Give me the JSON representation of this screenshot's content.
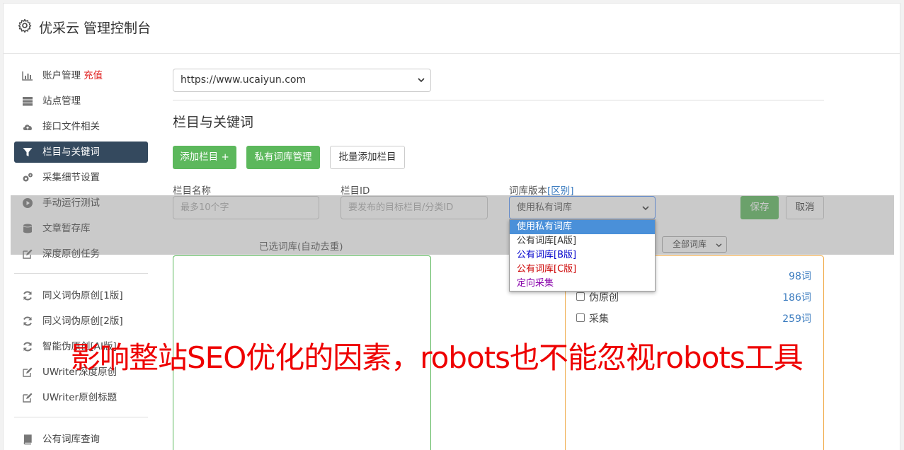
{
  "header": {
    "title": "优采云 管理控制台",
    "icon": "gear-icon"
  },
  "sidebar": {
    "items": [
      {
        "label": "账户管理",
        "extra": "充值",
        "icon": "bar-chart-icon"
      },
      {
        "label": "站点管理",
        "icon": "server-icon"
      },
      {
        "label": "接口文件相关",
        "icon": "cloud-upload-icon"
      },
      {
        "label": "栏目与关键词",
        "icon": "filter-icon",
        "active": true
      },
      {
        "label": "采集细节设置",
        "icon": "gears-icon"
      },
      {
        "label": "手动运行测试",
        "icon": "play-circle-icon"
      },
      {
        "label": "文章暂存库",
        "icon": "database-icon"
      },
      {
        "label": "深度原创任务",
        "icon": "edit-icon"
      },
      {
        "label": "同义词伪原创[1版]",
        "icon": "refresh-icon"
      },
      {
        "label": "同义词伪原创[2版]",
        "icon": "refresh-icon"
      },
      {
        "label": "智能伪原创[AI版]",
        "icon": "refresh-icon"
      },
      {
        "label": "UWriter深度原创",
        "icon": "edit-icon"
      },
      {
        "label": "UWriter原创标题",
        "icon": "edit-icon"
      },
      {
        "label": "公有词库查询",
        "icon": "book-icon"
      }
    ]
  },
  "site_select": {
    "value": "https://www.ucaiyun.com"
  },
  "section_title": "栏目与关键词",
  "toolbar": {
    "add_column": "添加栏目 +",
    "private_lib": "私有词库管理",
    "batch_add": "批量添加栏目"
  },
  "form": {
    "name_label": "栏目名称",
    "name_placeholder": "最多10个字",
    "id_label": "栏目ID",
    "id_placeholder": "要发布的目标栏目/分类ID",
    "version_label": "词库版本",
    "version_link": "[区别]",
    "version_value": "使用私有词库",
    "save": "保存",
    "cancel": "取消"
  },
  "dropdown": {
    "options": [
      {
        "label": "使用私有词库",
        "color": "#ffffff",
        "selected": true
      },
      {
        "label": "公有词库[A版]",
        "color": "#333333"
      },
      {
        "label": "公有词库[B版]",
        "color": "#0000cc"
      },
      {
        "label": "公有词库[C版]",
        "color": "#cc0000"
      },
      {
        "label": "定向采集",
        "color": "#8800aa"
      }
    ]
  },
  "selected_box": {
    "caption": "已选词库(自动去重)"
  },
  "library": {
    "filter_value": "全部词库",
    "rows": [
      {
        "name": "",
        "count": "98词"
      },
      {
        "name": "伪原创",
        "count": "186词"
      },
      {
        "name": "采集",
        "count": "259词"
      }
    ]
  },
  "watermark": "影响整站SEO优化的因素，robots也不能忽视robots工具",
  "colors": {
    "sidebar_active": "#34495e",
    "primary_green": "#5cb85c",
    "recharge_red": "#e02020",
    "link_blue": "#3a7bbf"
  }
}
